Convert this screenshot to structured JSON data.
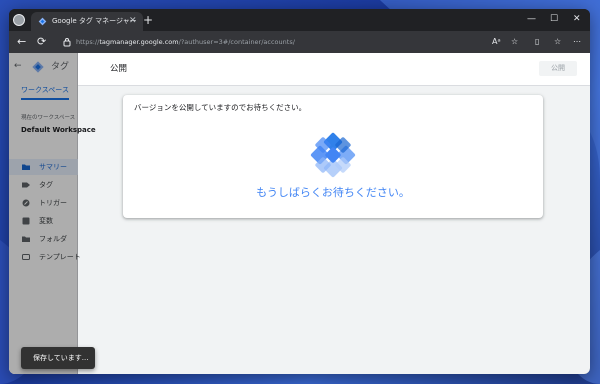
{
  "browser": {
    "tab_title": "Google タグ マネージャー",
    "tab_close": "✕",
    "new_tab": "+",
    "url_prefix": "https://",
    "url_host": "tagmanager.google.com",
    "url_path": "/?authuser=3#/container/accounts/",
    "minimize": "—",
    "maximize": "☐",
    "close": "✕",
    "back": "←",
    "reload": "⟳",
    "reader": "Aᵃ",
    "favorite": "☆",
    "split": "▯",
    "favorites": "☆",
    "more": "⋯"
  },
  "sidebar": {
    "back": "←",
    "app_name": "タグ",
    "workspace_tab": "ワークスペース",
    "current_workspace_label": "現在のワークスペース",
    "current_workspace_value": "Default Workspace",
    "items": [
      {
        "label": "サマリー",
        "icon": "folder-icon",
        "active": true
      },
      {
        "label": "タグ",
        "icon": "tag-icon",
        "active": false
      },
      {
        "label": "トリガー",
        "icon": "trigger-icon",
        "active": false
      },
      {
        "label": "変数",
        "icon": "variables-icon",
        "active": false
      },
      {
        "label": "フォルダ",
        "icon": "folder-icon",
        "active": false
      },
      {
        "label": "テンプレート",
        "icon": "template-icon",
        "active": false
      }
    ]
  },
  "main": {
    "title": "公開",
    "publish_button": "公開",
    "card_text": "バージョンを公開していますのでお待ちください。",
    "waiting_text": "もうしばらくお待ちください。"
  },
  "snackbar": {
    "text": "保存しています..."
  },
  "colors": {
    "accent": "#1a73e8",
    "waiting_text": "#4285f4",
    "snackbar_bg": "#323232"
  }
}
